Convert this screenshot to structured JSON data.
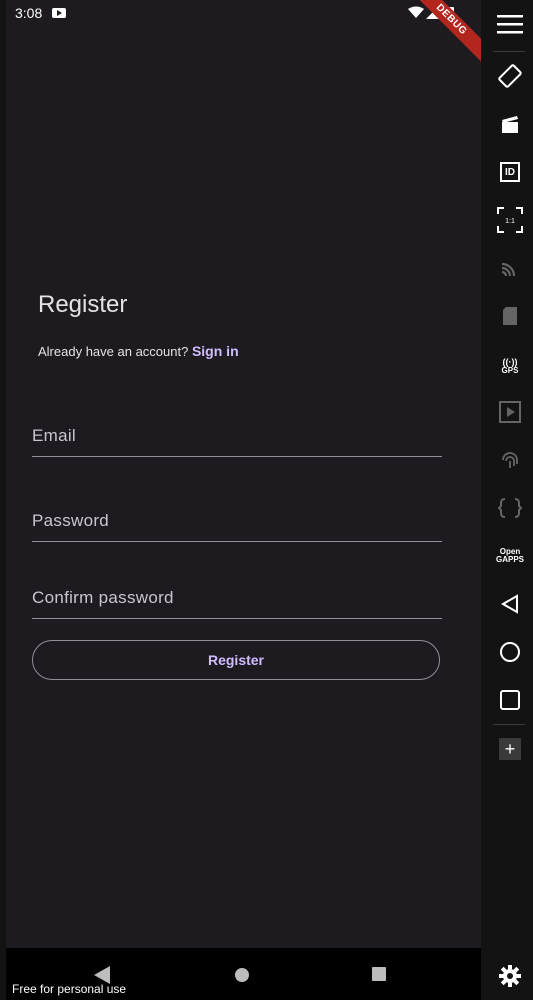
{
  "status_bar": {
    "time": "3:08"
  },
  "debug_banner": "DEBUG",
  "register_page": {
    "title": "Register",
    "signin_prompt": "Already have an account?",
    "signin_link": "Sign in",
    "email_placeholder": "Email",
    "password_placeholder": "Password",
    "confirm_placeholder": "Confirm password",
    "register_button": "Register"
  },
  "emulator": {
    "watermark": "Free for personal use",
    "toolbar": {
      "id_label": "ID",
      "scale_label": "1:1",
      "gps_label": "GPS",
      "opengapps_label": "Open GAPPS",
      "plus_label": "+"
    },
    "toolbar_icons": [
      "menu-icon",
      "rotate-icon",
      "clapperboard-icon",
      "id-icon",
      "scale-icon",
      "cast-icon",
      "sim-icon",
      "gps-icon",
      "media-icon",
      "fingerprint-icon",
      "braces-icon",
      "opengapps-icon",
      "back-icon",
      "home-icon",
      "recents-icon",
      "plus-icon",
      "settings-icon"
    ]
  }
}
